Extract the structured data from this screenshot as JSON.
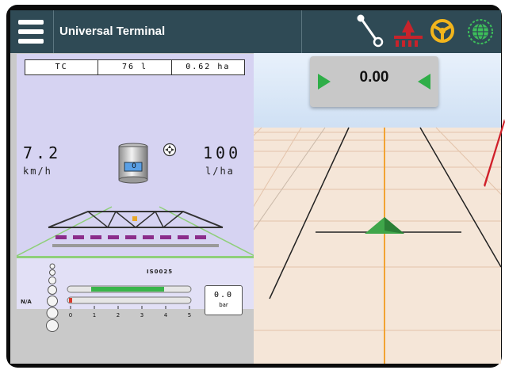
{
  "header": {
    "title": "Universal Terminal",
    "icons": [
      "menu-icon",
      "implement-link-icon",
      "boom-sections-icon",
      "steering-wheel-icon",
      "gnss-globe-icon"
    ],
    "colors": {
      "bar": "#2f4a55",
      "steering": "#f2b51c",
      "boom": "#c8232b",
      "gnss": "#3dbf5a"
    }
  },
  "guidance": {
    "cross_track_value": "0.00"
  },
  "product": {
    "tabs": [
      "TC",
      "76 l",
      "0.62 ha"
    ],
    "speed_value": "7.2",
    "speed_unit": "km/h",
    "rate_value": "100",
    "rate_unit": "l/ha",
    "tank_value": "0"
  },
  "nozzle": {
    "status": "N/A",
    "name": "IS0025",
    "scale": [
      "0",
      "1",
      "2",
      "3",
      "4",
      "5"
    ],
    "pressure_value": "0.0",
    "pressure_unit": "bar"
  }
}
